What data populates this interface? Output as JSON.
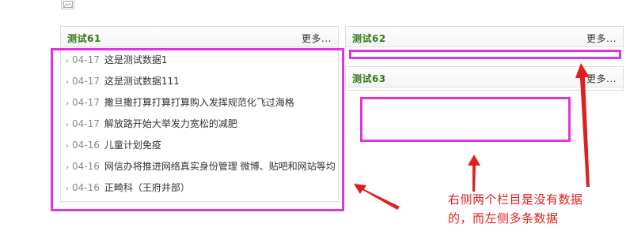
{
  "panels": {
    "p61": {
      "title": "测试61",
      "more": "更多..."
    },
    "p62": {
      "title": "测试62",
      "more": "更多..."
    },
    "p63": {
      "title": "测试63",
      "more": "更多..."
    }
  },
  "list_61": [
    {
      "date": "04-17",
      "title": "这是测试数据1"
    },
    {
      "date": "04-17",
      "title": "这是测试数据111"
    },
    {
      "date": "04-17",
      "title": "撒旦撒打算打算打算购入发挥规范化飞过海格"
    },
    {
      "date": "04-17",
      "title": "解放路开始大举发力宽松的减肥"
    },
    {
      "date": "04-16",
      "title": "儿童计划免疫"
    },
    {
      "date": "04-16",
      "title": "网信办将推进网络真实身份管理 微博、贴吧和网站等均"
    },
    {
      "date": "04-16",
      "title": "正畸科（王府井部）"
    }
  ],
  "annotation": {
    "line1": "右侧两个栏目是没有数据",
    "line2": "的，而左侧多条数据"
  },
  "colors": {
    "highlight": "#e431e6",
    "annotation": "#e02020",
    "panel_title": "#2f7d12"
  }
}
